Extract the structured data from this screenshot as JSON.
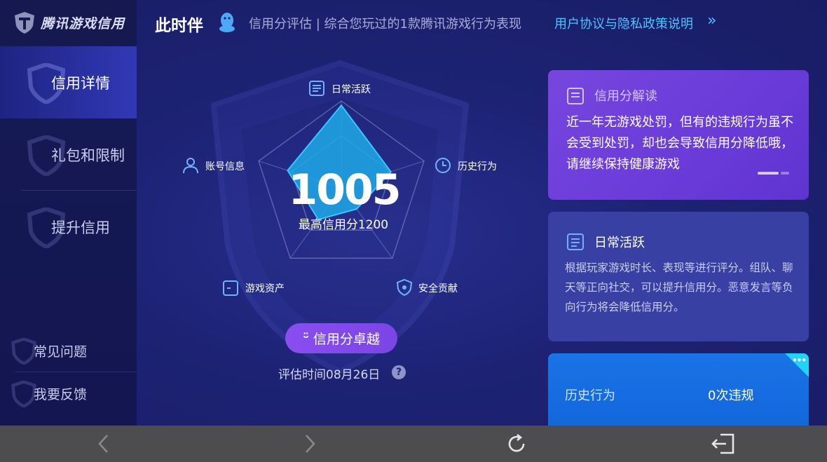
{
  "brand": {
    "name": "腾讯游戏信用",
    "logo": "shield-logo-icon"
  },
  "sidebar": {
    "items": [
      {
        "label": "信用详情",
        "active": true
      },
      {
        "label": "礼包和限制",
        "active": false
      },
      {
        "label": "提升信用",
        "active": false
      }
    ],
    "footer": [
      {
        "label": "常见问题"
      },
      {
        "label": "我要反馈"
      }
    ]
  },
  "header": {
    "user_name": "此时伴",
    "subtitle": "信用分评估 | 综合您玩过的1款腾讯游戏行为表现",
    "link": "用户协议与隐私政策说明",
    "link_arrow": "»"
  },
  "radar": {
    "axes": [
      {
        "label": "日常活跃",
        "icon": "list-icon"
      },
      {
        "label": "历史行为",
        "icon": "clock-icon"
      },
      {
        "label": "安全贡献",
        "icon": "shield-check-icon"
      },
      {
        "label": "游戏资产",
        "icon": "wallet-icon"
      },
      {
        "label": "账号信息",
        "icon": "user-icon"
      }
    ],
    "values": [
      0.95,
      0.6,
      0.3,
      0.45,
      0.65
    ],
    "score": "1005",
    "max_label": "最高信用分1200"
  },
  "grade_button": {
    "label": "信用分卓越",
    "icon": "smile-icon"
  },
  "eval_time": "评估时间08月26日",
  "help": "?",
  "cards": {
    "interpret": {
      "title": "信用分解读",
      "body": "近一年无游戏处罚，但有的违规行为虽不会受到处罚，却也会导致信用分降低哦，请继续保持健康游戏"
    },
    "daily": {
      "title": "日常活跃",
      "body": "根据玩家游戏时长、表现等进行评分。组队、聊天等正向社交，可以提升信用分。恶意发言等负向行为将会降低信用分。"
    },
    "history": {
      "label": "历史行为",
      "value": "0次违规",
      "corner": "•••"
    }
  },
  "colors": {
    "accent_cyan": "#4fc3ff",
    "radar_fill": "#1ea9e8",
    "card_purple": "#7845df",
    "card_blue": "#1a74e6"
  },
  "bottombar": [
    "back-icon",
    "forward-icon",
    "refresh-icon",
    "exit-icon"
  ]
}
